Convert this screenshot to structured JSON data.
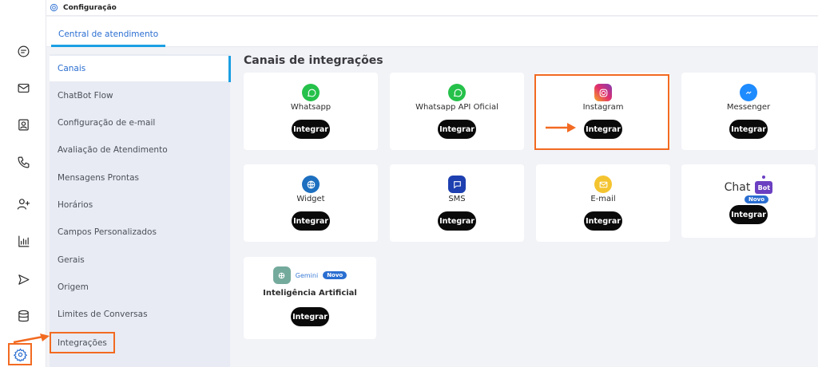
{
  "header": {
    "title": "Configuração"
  },
  "tabs": [
    {
      "label": "Central de atendimento"
    }
  ],
  "menu": {
    "items": [
      {
        "label": "Canais"
      },
      {
        "label": "ChatBot Flow"
      },
      {
        "label": "Configuração de e-mail"
      },
      {
        "label": "Avaliação de Atendimento"
      },
      {
        "label": "Mensagens Prontas"
      },
      {
        "label": "Horários"
      },
      {
        "label": "Campos Personalizados"
      },
      {
        "label": "Gerais"
      },
      {
        "label": "Origem"
      },
      {
        "label": "Limites de Conversas"
      },
      {
        "label": "Integrações"
      }
    ]
  },
  "main": {
    "title": "Canais de integrações",
    "button_label": "Integrar",
    "cards": [
      {
        "name": "Whatsapp",
        "icon": "whatsapp-icon",
        "color": "#25c14a"
      },
      {
        "name": "Whatsapp API Oficial",
        "icon": "whatsapp-icon",
        "color": "#25c14a"
      },
      {
        "name": "Instagram",
        "icon": "instagram-icon",
        "color": "#e1306c"
      },
      {
        "name": "Messenger",
        "icon": "messenger-icon",
        "color": "#1e8bff"
      },
      {
        "name": "Widget",
        "icon": "globe-icon",
        "color": "#1d6fbf"
      },
      {
        "name": "SMS",
        "icon": "sms-icon",
        "color": "#1d3fb0"
      },
      {
        "name": "E-mail",
        "icon": "email-icon",
        "color": "#f4c430"
      },
      {
        "name": "Chat",
        "badge": "Bot",
        "tag": "Novo",
        "icon": "chatbot-logo"
      },
      {
        "name": "Inteligência Artificial",
        "provider": "Gemini",
        "tag": "Novo",
        "icon": "openai-icon",
        "color": "#74aa9c"
      }
    ]
  },
  "colors": {
    "accent": "#2a6ed1",
    "highlight": "#f26a21",
    "button": "#0a0a0a"
  }
}
